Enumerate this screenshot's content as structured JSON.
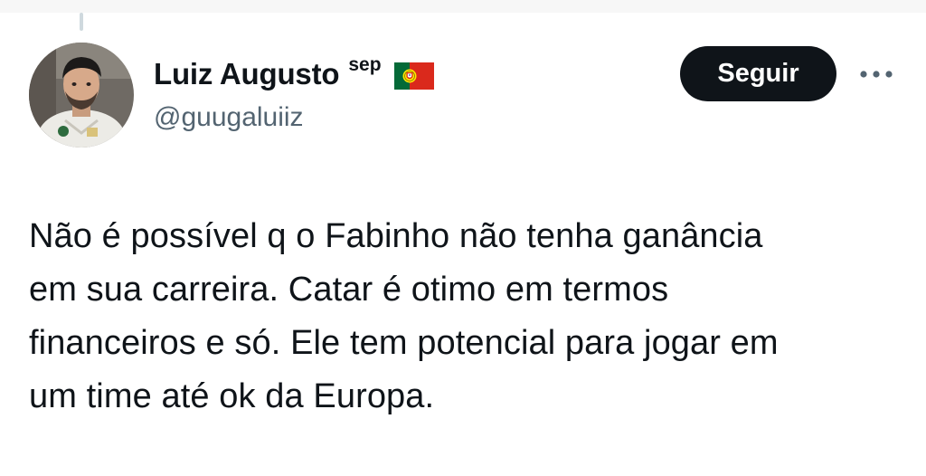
{
  "author": {
    "display_name": "Luiz Augusto",
    "name_suffix": "sep",
    "flag_icon": "portugal-flag-icon",
    "handle": "@guugaluiiz",
    "avatar_icon": "user-avatar"
  },
  "actions": {
    "follow_label": "Seguir",
    "more_icon": "more-horizontal-icon"
  },
  "tweet": {
    "lines": [
      "Não é possível q o Fabinho não tenha ganância",
      "em sua carreira. Catar é otimo em termos",
      "financeiros e só. Ele tem potencial para jogar em",
      "um time até ok da Europa."
    ]
  },
  "colors": {
    "text": "#0f1419",
    "secondary_text": "#536471",
    "follow_button_bg": "#0f1419",
    "follow_button_text": "#ffffff",
    "flag_green": "#046a38",
    "flag_red": "#da291c"
  }
}
